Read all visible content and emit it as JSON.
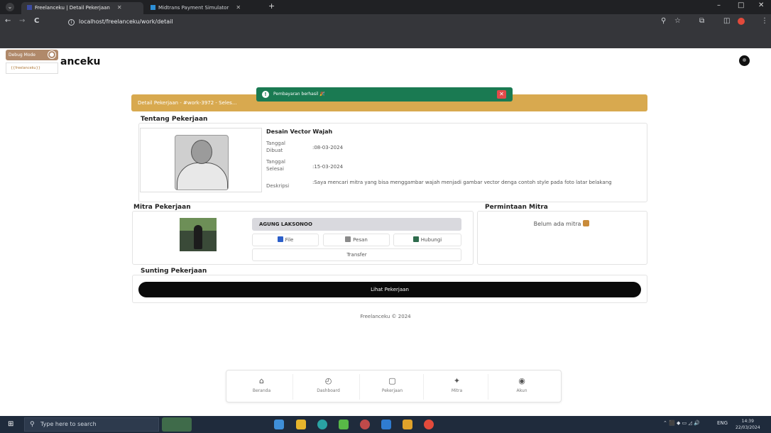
{
  "browser": {
    "tabs": [
      {
        "label": "Freelanceku | Detail Pekerjaan",
        "favicon_color": "#3c4ba0",
        "active": true
      },
      {
        "label": "Midtrans Payment Simulator",
        "favicon_color": "#2c8fd6",
        "active": false
      }
    ],
    "url": "localhost/freelanceku/work/detail",
    "new_tab": "+",
    "tab_close": "✕",
    "controls": {
      "back": "←",
      "forward": "→",
      "reload": "C",
      "minimize": "–",
      "maximize": "□",
      "close": "✕",
      "zoom": "⚲",
      "star": "☆",
      "extensions": "⧉",
      "sidebar": "◫",
      "menu": "⋮"
    }
  },
  "debug": {
    "badge": "Debug Mode",
    "sub": "{{freelanceku}}"
  },
  "app": {
    "brand": "anceku"
  },
  "header": {
    "title": "Detail Pekerjaan - #work-3972 - Seles..."
  },
  "toast": {
    "message": "Pembayaran berhasil 🎉",
    "icon": "!",
    "close": "✕",
    "color": "#1a7a52"
  },
  "job": {
    "section": "Tentang Pekerjaan",
    "name": "Desain Vector Wajah",
    "fields": [
      {
        "label": "Tanggal Dibuat",
        "value": ":08-03-2024"
      },
      {
        "label": "Tanggal Selesai",
        "value": ":15-03-2024"
      },
      {
        "label": "Deskripsi",
        "value": ":Saya mencari mitra yang bisa menggambar wajah menjadi gambar vector denga contoh style pada foto latar belakang"
      }
    ]
  },
  "partner": {
    "section": "Mitra Pekerjaan",
    "name": "AGUNG LAKSONOO",
    "actions": [
      {
        "label": "File",
        "icon": "file-icon",
        "color": "#2b5ec9"
      },
      {
        "label": "Pesan",
        "icon": "message-icon",
        "color": "#8a8a8a"
      },
      {
        "label": "Hubungi",
        "icon": "phone-icon",
        "color": "#2e6b4c"
      }
    ],
    "transfer": "Transfer"
  },
  "requests": {
    "section": "Permintaan Mitra",
    "empty": "Belum ada mitra"
  },
  "edit": {
    "section": "Sunting Pekerjaan",
    "button": "Lihat Pekerjaan"
  },
  "footer": "Freelanceku © 2024",
  "bottom_nav": [
    {
      "label": "Beranda",
      "icon": "home-icon",
      "glyph": "⌂"
    },
    {
      "label": "Dashboard",
      "icon": "dashboard-icon",
      "glyph": "◴"
    },
    {
      "label": "Pekerjaan",
      "icon": "work-icon",
      "glyph": "▢"
    },
    {
      "label": "Mitra",
      "icon": "partner-icon",
      "glyph": "✦"
    },
    {
      "label": "Akun",
      "icon": "account-icon",
      "glyph": "◉"
    }
  ],
  "taskbar": {
    "search_placeholder": "Type here to search",
    "lang": "ENG",
    "time": "14:39",
    "date": "22/03/2024",
    "tray": "⌃ ⬛ ◆ ▭ ◿ 🔊",
    "apps": [
      "#3f8fd8",
      "#e6b52c",
      "#2aa3a3",
      "#58b947",
      "#c04a4a",
      "#2f7cd1",
      "#e0a22a",
      "#e24a3b"
    ]
  }
}
